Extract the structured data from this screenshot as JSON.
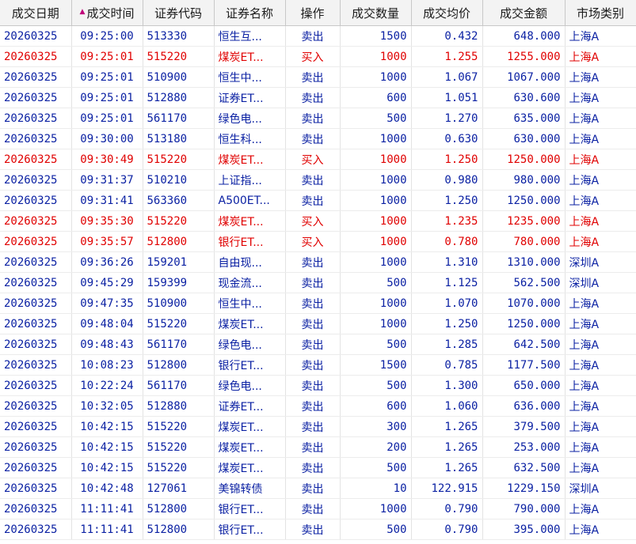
{
  "headers": {
    "date": "成交日期",
    "time": "成交时间",
    "code": "证券代码",
    "name": "证券名称",
    "op": "操作",
    "qty": "成交数量",
    "avg": "成交均价",
    "amount": "成交金额",
    "market": "市场类别"
  },
  "sort": {
    "column": "time",
    "direction": "ascending",
    "icon": "sort-ascending-icon"
  },
  "colors": {
    "buy": "#e00000",
    "sell": "#0b21a3",
    "header_bg": "#f3f3f3",
    "sort_icon": "#c0007a"
  },
  "rows": [
    {
      "date": "20260325",
      "time": "09:25:00",
      "code": "513330",
      "name": "恒生互...",
      "op": "卖出",
      "qty": "1500",
      "avg": "0.432",
      "amount": "648.000",
      "market": "上海A",
      "side": "sell"
    },
    {
      "date": "20260325",
      "time": "09:25:01",
      "code": "515220",
      "name": "煤炭ET...",
      "op": "买入",
      "qty": "1000",
      "avg": "1.255",
      "amount": "1255.000",
      "market": "上海A",
      "side": "buy"
    },
    {
      "date": "20260325",
      "time": "09:25:01",
      "code": "510900",
      "name": "恒生中...",
      "op": "卖出",
      "qty": "1000",
      "avg": "1.067",
      "amount": "1067.000",
      "market": "上海A",
      "side": "sell"
    },
    {
      "date": "20260325",
      "time": "09:25:01",
      "code": "512880",
      "name": "证券ET...",
      "op": "卖出",
      "qty": "600",
      "avg": "1.051",
      "amount": "630.600",
      "market": "上海A",
      "side": "sell"
    },
    {
      "date": "20260325",
      "time": "09:25:01",
      "code": "561170",
      "name": "绿色电...",
      "op": "卖出",
      "qty": "500",
      "avg": "1.270",
      "amount": "635.000",
      "market": "上海A",
      "side": "sell"
    },
    {
      "date": "20260325",
      "time": "09:30:00",
      "code": "513180",
      "name": "恒生科...",
      "op": "卖出",
      "qty": "1000",
      "avg": "0.630",
      "amount": "630.000",
      "market": "上海A",
      "side": "sell"
    },
    {
      "date": "20260325",
      "time": "09:30:49",
      "code": "515220",
      "name": "煤炭ET...",
      "op": "买入",
      "qty": "1000",
      "avg": "1.250",
      "amount": "1250.000",
      "market": "上海A",
      "side": "buy"
    },
    {
      "date": "20260325",
      "time": "09:31:37",
      "code": "510210",
      "name": "上证指...",
      "op": "卖出",
      "qty": "1000",
      "avg": "0.980",
      "amount": "980.000",
      "market": "上海A",
      "side": "sell"
    },
    {
      "date": "20260325",
      "time": "09:31:41",
      "code": "563360",
      "name": "A500ET...",
      "op": "卖出",
      "qty": "1000",
      "avg": "1.250",
      "amount": "1250.000",
      "market": "上海A",
      "side": "sell"
    },
    {
      "date": "20260325",
      "time": "09:35:30",
      "code": "515220",
      "name": "煤炭ET...",
      "op": "买入",
      "qty": "1000",
      "avg": "1.235",
      "amount": "1235.000",
      "market": "上海A",
      "side": "buy"
    },
    {
      "date": "20260325",
      "time": "09:35:57",
      "code": "512800",
      "name": "银行ET...",
      "op": "买入",
      "qty": "1000",
      "avg": "0.780",
      "amount": "780.000",
      "market": "上海A",
      "side": "buy"
    },
    {
      "date": "20260325",
      "time": "09:36:26",
      "code": "159201",
      "name": "自由现...",
      "op": "卖出",
      "qty": "1000",
      "avg": "1.310",
      "amount": "1310.000",
      "market": "深圳A",
      "side": "sell"
    },
    {
      "date": "20260325",
      "time": "09:45:29",
      "code": "159399",
      "name": "现金流...",
      "op": "卖出",
      "qty": "500",
      "avg": "1.125",
      "amount": "562.500",
      "market": "深圳A",
      "side": "sell"
    },
    {
      "date": "20260325",
      "time": "09:47:35",
      "code": "510900",
      "name": "恒生中...",
      "op": "卖出",
      "qty": "1000",
      "avg": "1.070",
      "amount": "1070.000",
      "market": "上海A",
      "side": "sell"
    },
    {
      "date": "20260325",
      "time": "09:48:04",
      "code": "515220",
      "name": "煤炭ET...",
      "op": "卖出",
      "qty": "1000",
      "avg": "1.250",
      "amount": "1250.000",
      "market": "上海A",
      "side": "sell"
    },
    {
      "date": "20260325",
      "time": "09:48:43",
      "code": "561170",
      "name": "绿色电...",
      "op": "卖出",
      "qty": "500",
      "avg": "1.285",
      "amount": "642.500",
      "market": "上海A",
      "side": "sell"
    },
    {
      "date": "20260325",
      "time": "10:08:23",
      "code": "512800",
      "name": "银行ET...",
      "op": "卖出",
      "qty": "1500",
      "avg": "0.785",
      "amount": "1177.500",
      "market": "上海A",
      "side": "sell"
    },
    {
      "date": "20260325",
      "time": "10:22:24",
      "code": "561170",
      "name": "绿色电...",
      "op": "卖出",
      "qty": "500",
      "avg": "1.300",
      "amount": "650.000",
      "market": "上海A",
      "side": "sell"
    },
    {
      "date": "20260325",
      "time": "10:32:05",
      "code": "512880",
      "name": "证券ET...",
      "op": "卖出",
      "qty": "600",
      "avg": "1.060",
      "amount": "636.000",
      "market": "上海A",
      "side": "sell"
    },
    {
      "date": "20260325",
      "time": "10:42:15",
      "code": "515220",
      "name": "煤炭ET...",
      "op": "卖出",
      "qty": "300",
      "avg": "1.265",
      "amount": "379.500",
      "market": "上海A",
      "side": "sell"
    },
    {
      "date": "20260325",
      "time": "10:42:15",
      "code": "515220",
      "name": "煤炭ET...",
      "op": "卖出",
      "qty": "200",
      "avg": "1.265",
      "amount": "253.000",
      "market": "上海A",
      "side": "sell"
    },
    {
      "date": "20260325",
      "time": "10:42:15",
      "code": "515220",
      "name": "煤炭ET...",
      "op": "卖出",
      "qty": "500",
      "avg": "1.265",
      "amount": "632.500",
      "market": "上海A",
      "side": "sell"
    },
    {
      "date": "20260325",
      "time": "10:42:48",
      "code": "127061",
      "name": "美锦转债",
      "op": "卖出",
      "qty": "10",
      "avg": "122.915",
      "amount": "1229.150",
      "market": "深圳A",
      "side": "sell"
    },
    {
      "date": "20260325",
      "time": "11:11:41",
      "code": "512800",
      "name": "银行ET...",
      "op": "卖出",
      "qty": "1000",
      "avg": "0.790",
      "amount": "790.000",
      "market": "上海A",
      "side": "sell"
    },
    {
      "date": "20260325",
      "time": "11:11:41",
      "code": "512800",
      "name": "银行ET...",
      "op": "卖出",
      "qty": "500",
      "avg": "0.790",
      "amount": "395.000",
      "market": "上海A",
      "side": "sell"
    }
  ]
}
